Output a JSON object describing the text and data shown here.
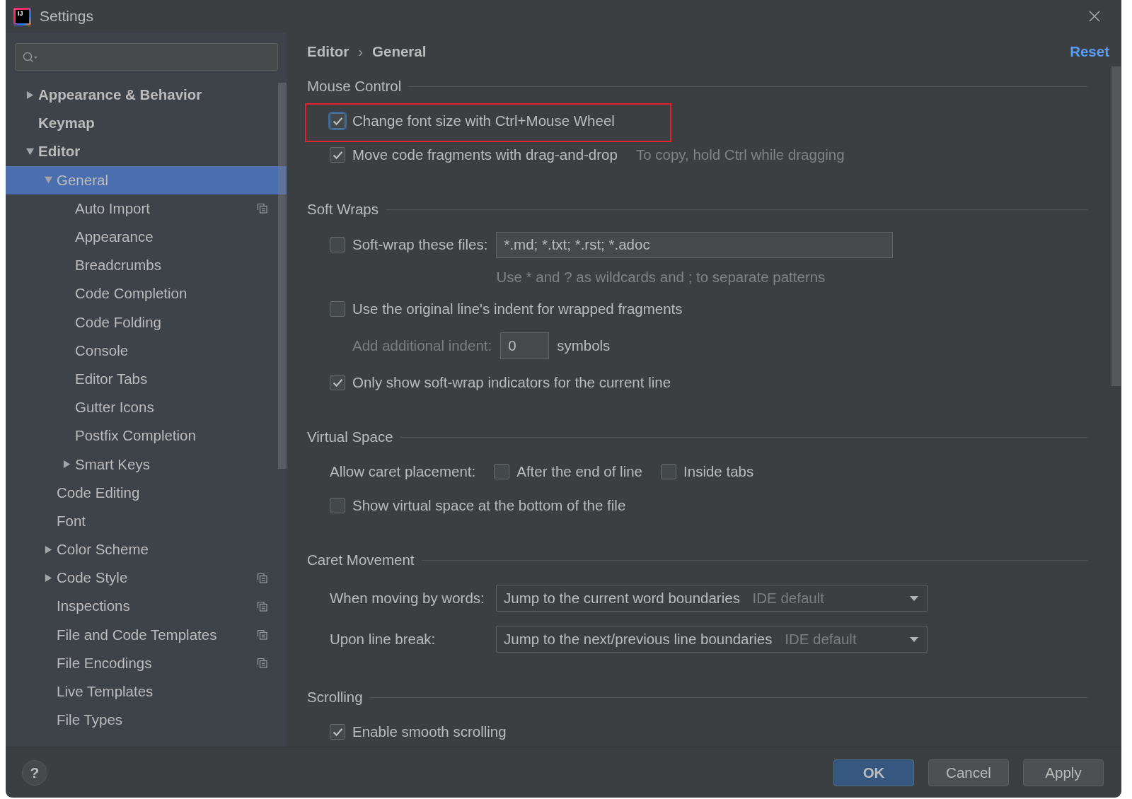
{
  "window": {
    "title": "Settings",
    "logo_text": "IJ"
  },
  "sidebar": {
    "items": [
      {
        "label": "Appearance & Behavior",
        "kind": "branch",
        "expanded": false,
        "selected": false,
        "project_scope": false
      },
      {
        "label": "Keymap",
        "kind": "leaf",
        "selected": false,
        "project_scope": false
      },
      {
        "label": "Editor",
        "kind": "branch",
        "expanded": true,
        "selected": false,
        "project_scope": false,
        "children": [
          {
            "label": "General",
            "kind": "branch",
            "expanded": true,
            "selected": true,
            "project_scope": false,
            "children": [
              {
                "label": "Auto Import",
                "kind": "leaf",
                "selected": false,
                "project_scope": true
              },
              {
                "label": "Appearance",
                "kind": "leaf",
                "selected": false,
                "project_scope": false
              },
              {
                "label": "Breadcrumbs",
                "kind": "leaf",
                "selected": false,
                "project_scope": false
              },
              {
                "label": "Code Completion",
                "kind": "leaf",
                "selected": false,
                "project_scope": false
              },
              {
                "label": "Code Folding",
                "kind": "leaf",
                "selected": false,
                "project_scope": false
              },
              {
                "label": "Console",
                "kind": "leaf",
                "selected": false,
                "project_scope": false
              },
              {
                "label": "Editor Tabs",
                "kind": "leaf",
                "selected": false,
                "project_scope": false
              },
              {
                "label": "Gutter Icons",
                "kind": "leaf",
                "selected": false,
                "project_scope": false
              },
              {
                "label": "Postfix Completion",
                "kind": "leaf",
                "selected": false,
                "project_scope": false
              },
              {
                "label": "Smart Keys",
                "kind": "branch",
                "expanded": false,
                "selected": false,
                "project_scope": false
              }
            ]
          },
          {
            "label": "Code Editing",
            "kind": "leaf",
            "selected": false,
            "project_scope": false
          },
          {
            "label": "Font",
            "kind": "leaf",
            "selected": false,
            "project_scope": false
          },
          {
            "label": "Color Scheme",
            "kind": "branch",
            "expanded": false,
            "selected": false,
            "project_scope": false
          },
          {
            "label": "Code Style",
            "kind": "branch",
            "expanded": false,
            "selected": false,
            "project_scope": true
          },
          {
            "label": "Inspections",
            "kind": "leaf",
            "selected": false,
            "project_scope": true
          },
          {
            "label": "File and Code Templates",
            "kind": "leaf",
            "selected": false,
            "project_scope": true
          },
          {
            "label": "File Encodings",
            "kind": "leaf",
            "selected": false,
            "project_scope": true
          },
          {
            "label": "Live Templates",
            "kind": "leaf",
            "selected": false,
            "project_scope": false
          },
          {
            "label": "File Types",
            "kind": "leaf",
            "selected": false,
            "project_scope": false
          }
        ]
      }
    ]
  },
  "breadcrumb": {
    "items": [
      "Editor",
      "General"
    ],
    "separator": "›"
  },
  "reset_link": "Reset",
  "sections": [
    {
      "title": "Mouse Control",
      "rows": [
        {
          "kind": "checkbox",
          "label": "Change font size with Ctrl+Mouse Wheel",
          "checked": true,
          "focused": true,
          "highlighted": true
        },
        {
          "kind": "checkbox",
          "label": "Move code fragments with drag-and-drop",
          "checked": true,
          "focused": false,
          "highlighted": false,
          "hint": "To copy, hold Ctrl while dragging"
        }
      ]
    },
    {
      "title": "Soft Wraps",
      "rows": [
        {
          "kind": "checkbox_field",
          "label": "Soft-wrap these files:",
          "checked": false,
          "value": "*.md; *.txt; *.rst; *.adoc",
          "hint": "Use * and ? as wildcards and ; to separate patterns"
        },
        {
          "kind": "checkbox",
          "label": "Use the original line's indent for wrapped fragments",
          "checked": false,
          "focused": false,
          "highlighted": false
        },
        {
          "kind": "number_field",
          "label": "Add additional indent:",
          "value": "0",
          "unit": "symbols",
          "disabled": true
        },
        {
          "kind": "checkbox",
          "label": "Only show soft-wrap indicators for the current line",
          "checked": true,
          "focused": false,
          "highlighted": false
        }
      ]
    },
    {
      "title": "Virtual Space",
      "rows": [
        {
          "kind": "checkbox_group",
          "label": "Allow caret placement:",
          "options": [
            {
              "label": "After the end of line",
              "checked": false
            },
            {
              "label": "Inside tabs",
              "checked": false
            }
          ]
        },
        {
          "kind": "checkbox",
          "label": "Show virtual space at the bottom of the file",
          "checked": false,
          "focused": false,
          "highlighted": false
        }
      ]
    },
    {
      "title": "Caret Movement",
      "rows": [
        {
          "kind": "dropdown",
          "label": "When moving by words:",
          "value": "Jump to the current word boundaries",
          "note": "IDE default"
        },
        {
          "kind": "dropdown",
          "label": "Upon line break:",
          "value": "Jump to the next/previous line boundaries",
          "note": "IDE default"
        }
      ]
    },
    {
      "title": "Scrolling",
      "rows": [
        {
          "kind": "checkbox",
          "label": "Enable smooth scrolling",
          "checked": true,
          "focused": false,
          "highlighted": false
        }
      ]
    }
  ],
  "help_button": "?",
  "buttons": [
    {
      "label": "OK",
      "primary": true
    },
    {
      "label": "Cancel",
      "primary": false
    },
    {
      "label": "Apply",
      "primary": false
    }
  ]
}
